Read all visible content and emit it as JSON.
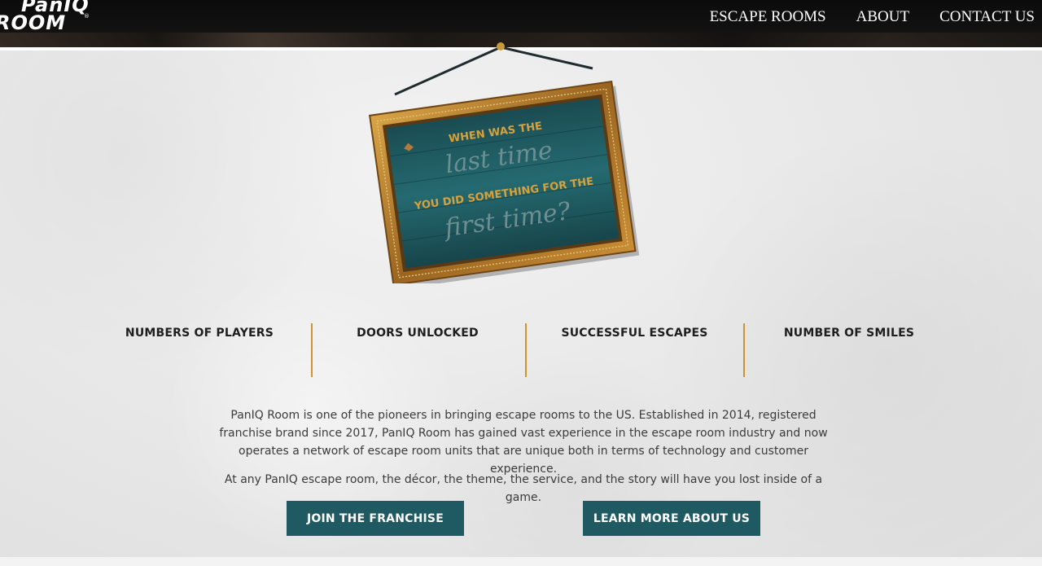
{
  "brand": {
    "logo_line1": "PanIQ",
    "logo_line2": "ROOM",
    "logo_mark": "®"
  },
  "nav": {
    "items": [
      "ESCAPE ROOMS",
      "ABOUT",
      "CONTACT US"
    ]
  },
  "frame": {
    "line1": "WHEN WAS THE",
    "line2": "last time",
    "line3": "YOU DID SOMETHING FOR THE",
    "line4": "first time?"
  },
  "stats": [
    "NUMBERS OF PLAYERS",
    "DOORS UNLOCKED",
    "SUCCESSFUL ESCAPES",
    "NUMBER OF SMILES"
  ],
  "about": {
    "paragraph1": "PanIQ Room is one of the pioneers in bringing escape rooms to the US. Established in 2014, registered franchise brand since 2017, PanIQ Room has gained vast experience in the escape room industry and now operates a network of escape room units that are unique both in terms of technology and customer experience.",
    "paragraph2": "At any PanIQ escape room, the décor, the theme, the service, and the story will have you lost inside of a game."
  },
  "buttons": {
    "join": "JOIN THE FRANCHISE",
    "learn": "LEARN MORE ABOUT US"
  },
  "colors": {
    "accent": "#d0942e",
    "button": "#1f5a62",
    "header": "#0b0b0b",
    "frame_gold": "#b5812e",
    "frame_inner": "#1d5a5e"
  }
}
